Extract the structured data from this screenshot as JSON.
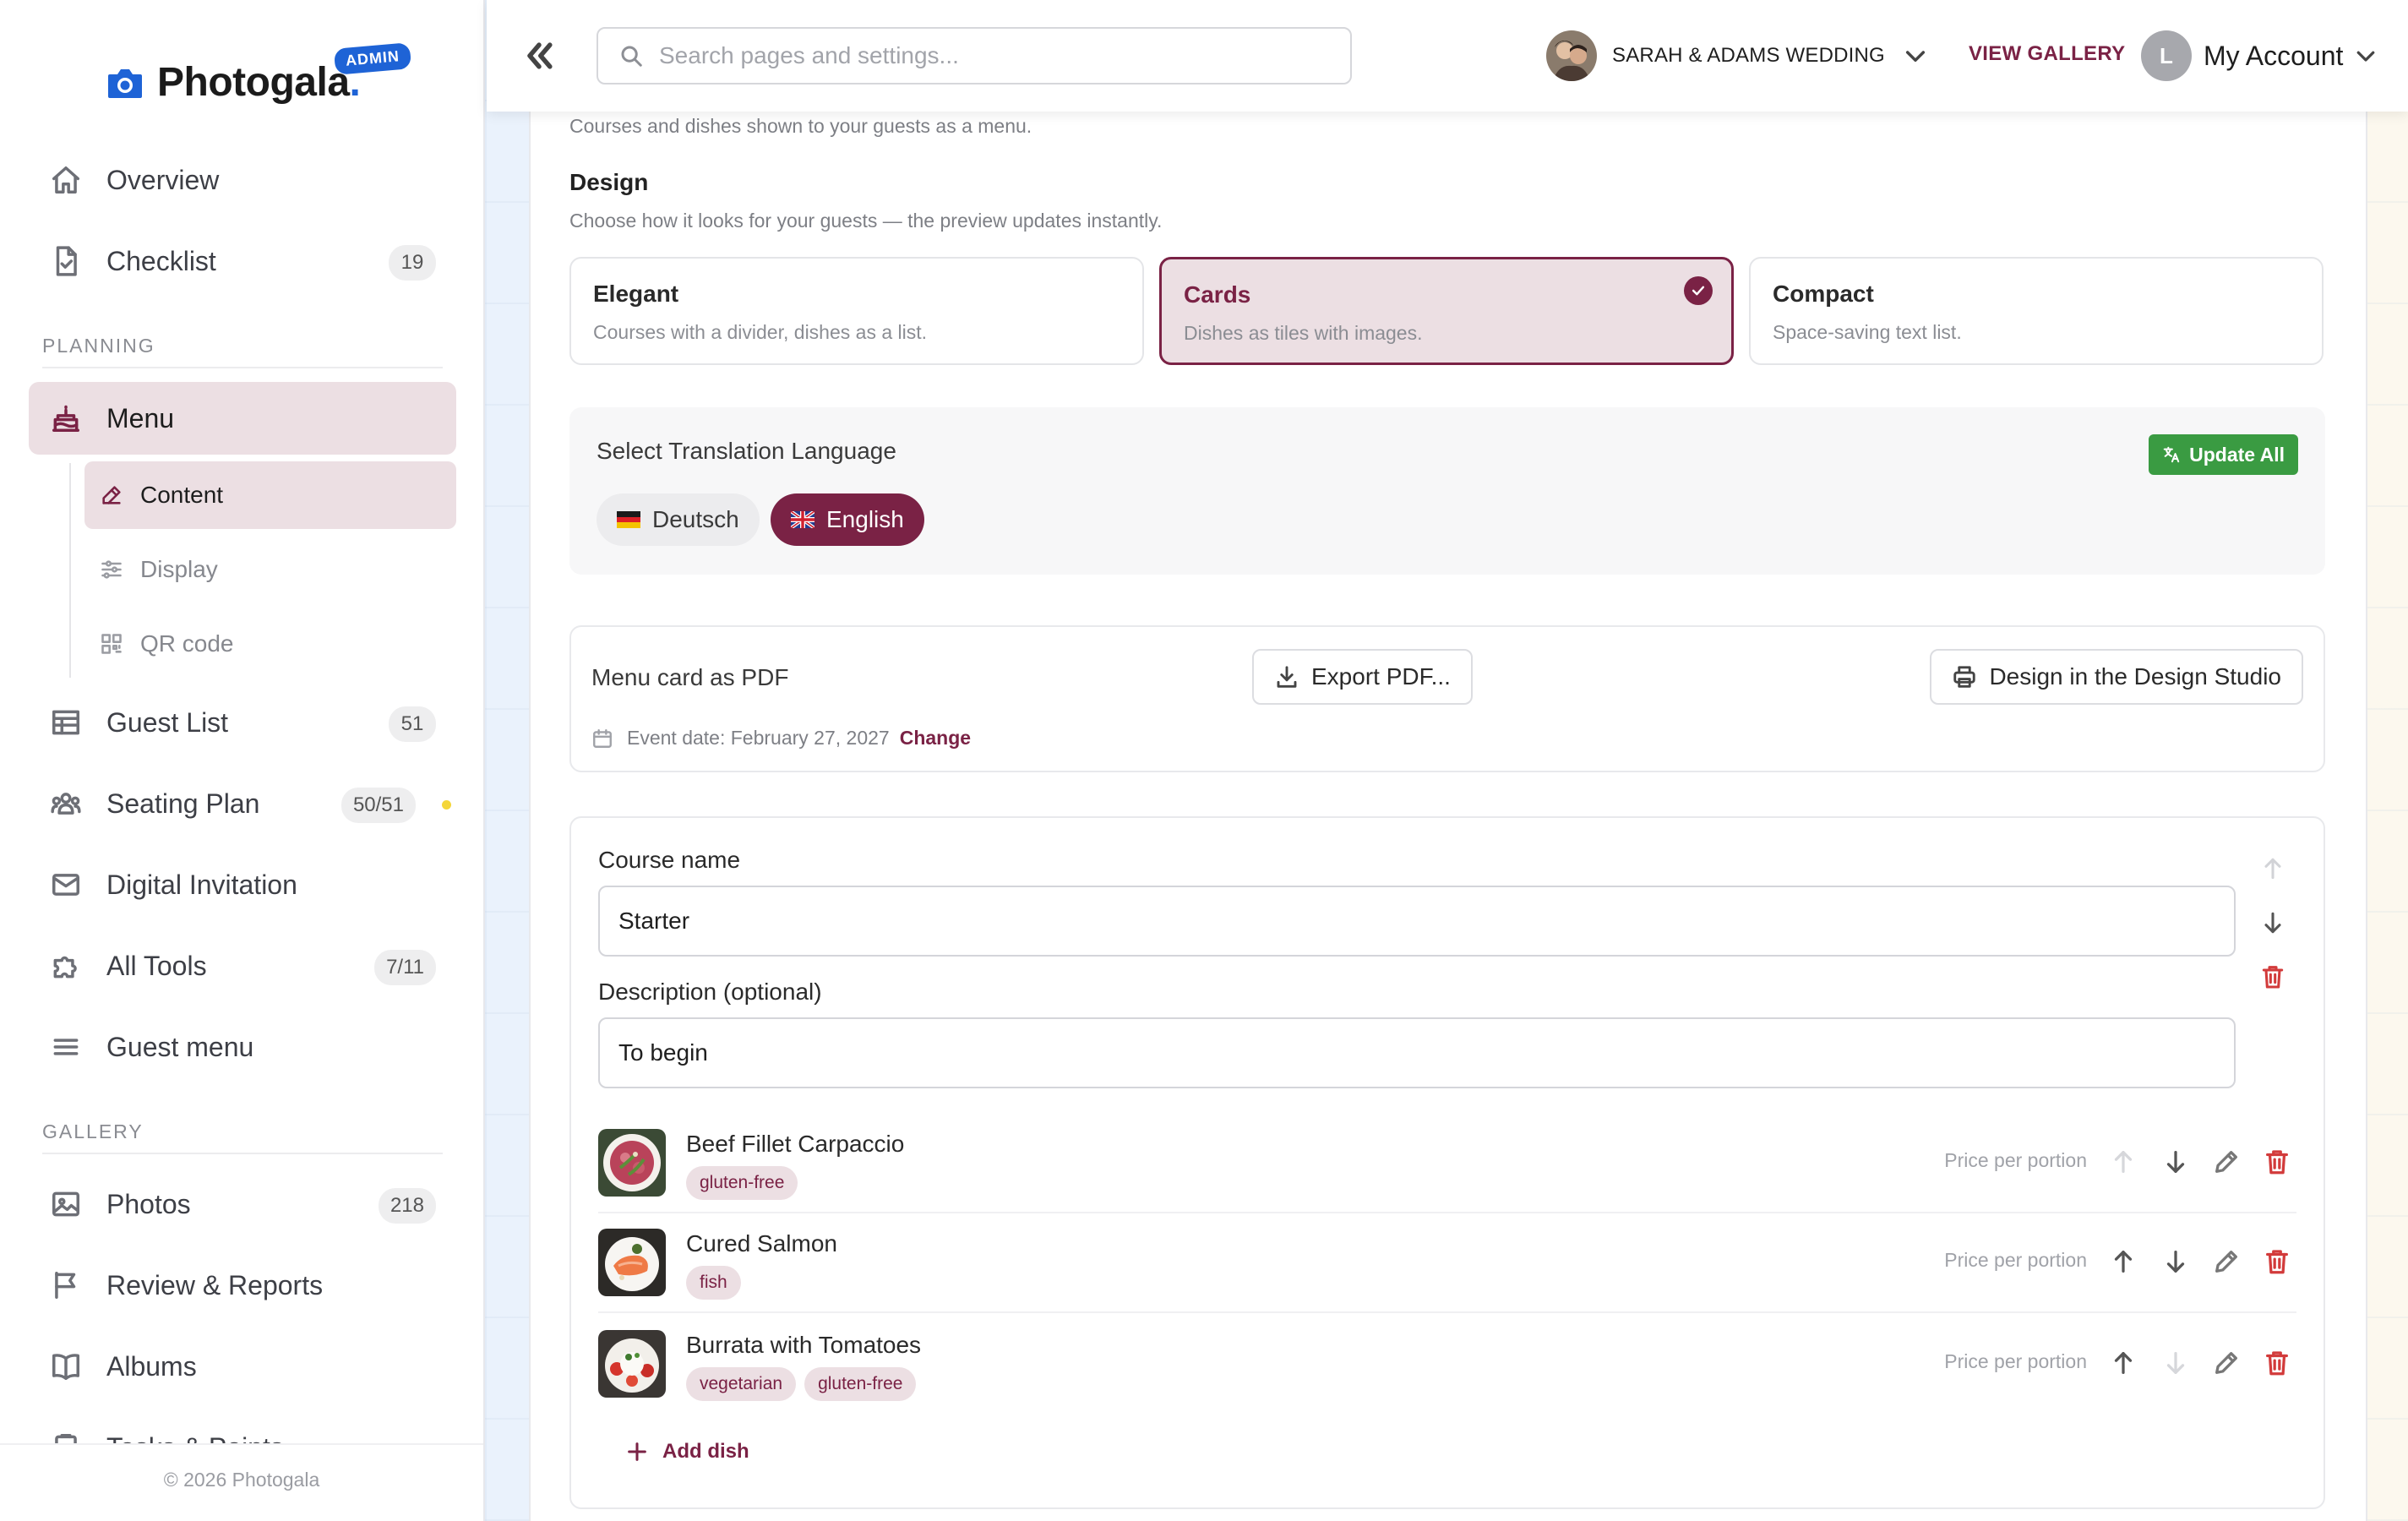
{
  "brand": {
    "name": "Photogala",
    "dot": ".",
    "badge": "ADMIN",
    "accent": "#7a2245",
    "logo_blue": "#1e63d6"
  },
  "sidebar": {
    "items_top": [
      {
        "label": "Overview",
        "icon": "home-icon"
      },
      {
        "label": "Checklist",
        "icon": "checklist-icon",
        "count": "19"
      }
    ],
    "planning_header": "PLANNING",
    "menu": {
      "label": "Menu",
      "icon": "cake-icon",
      "subitems": [
        {
          "label": "Content",
          "icon": "edit-icon",
          "active": true
        },
        {
          "label": "Display",
          "icon": "sliders-icon"
        },
        {
          "label": "QR code",
          "icon": "qr-icon"
        }
      ]
    },
    "items_planning": [
      {
        "label": "Guest List",
        "icon": "table-icon",
        "count": "51"
      },
      {
        "label": "Seating Plan",
        "icon": "users-icon",
        "count": "50/51",
        "status_color": "#f4d63a"
      },
      {
        "label": "Digital Invitation",
        "icon": "mail-icon"
      },
      {
        "label": "All Tools",
        "icon": "puzzle-icon",
        "count": "7/11"
      },
      {
        "label": "Guest menu",
        "icon": "list-icon"
      }
    ],
    "gallery_header": "GALLERY",
    "items_gallery": [
      {
        "label": "Photos",
        "icon": "image-icon",
        "count": "218"
      },
      {
        "label": "Review & Reports",
        "icon": "flag-icon"
      },
      {
        "label": "Albums",
        "icon": "book-icon"
      },
      {
        "label": "Tasks & Points",
        "icon": "task-icon"
      }
    ],
    "footer": "© 2026 Photogala"
  },
  "topbar": {
    "search_placeholder": "Search pages and settings...",
    "event_name": "SARAH & ADAMS WEDDING",
    "view_gallery": "VIEW GALLERY",
    "account_initial": "L",
    "account_label": "My Account"
  },
  "main": {
    "intro": "Courses and dishes shown to your guests as a menu.",
    "design": {
      "title": "Design",
      "subtitle": "Choose how it looks for your guests — the preview updates instantly.",
      "options": [
        {
          "title": "Elegant",
          "desc": "Courses with a divider, dishes as a list."
        },
        {
          "title": "Cards",
          "desc": "Dishes as tiles with images.",
          "selected": true
        },
        {
          "title": "Compact",
          "desc": "Space-saving text list."
        }
      ]
    },
    "translation": {
      "title": "Select Translation Language",
      "update_all": "Update All",
      "update_color": "#3a9b42",
      "languages": [
        {
          "label": "Deutsch",
          "flag": "germany-flag-icon"
        },
        {
          "label": "English",
          "flag": "uk-flag-icon",
          "selected": true
        }
      ]
    },
    "pdf": {
      "title": "Menu card as PDF",
      "export": "Export PDF...",
      "studio": "Design in the Design Studio",
      "event_date": "Event date: February 27, 2027",
      "change": "Change"
    },
    "course": {
      "name_label": "Course name",
      "name_value": "Starter",
      "desc_label": "Description (optional)",
      "desc_value": "To begin",
      "price_placeholder": "Price per portion",
      "dishes": [
        {
          "name": "Beef Fillet Carpaccio",
          "tags": [
            "gluten-free"
          ]
        },
        {
          "name": "Cured Salmon",
          "tags": [
            "fish"
          ]
        },
        {
          "name": "Burrata with Tomatoes",
          "tags": [
            "vegetarian",
            "gluten-free"
          ]
        }
      ],
      "add_dish": "Add dish"
    }
  }
}
